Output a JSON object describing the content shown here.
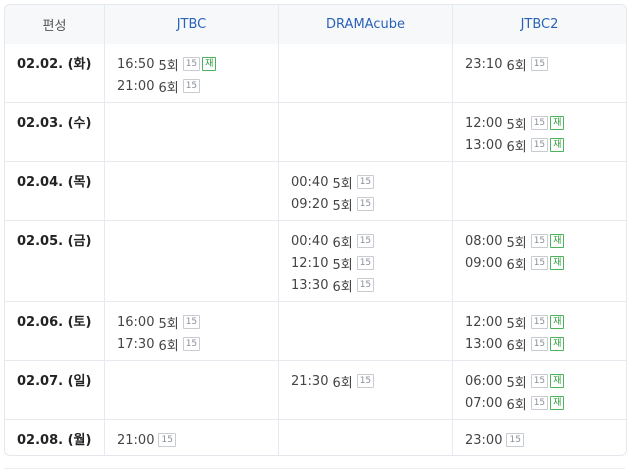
{
  "header": {
    "label": "편성",
    "channels": [
      "JTBC",
      "DRAMAcube",
      "JTBC2"
    ]
  },
  "rows": [
    {
      "date": "02.02. (화)",
      "slots": [
        [
          {
            "time": "16:50",
            "ep": "5회",
            "age": "15",
            "re": "재"
          },
          {
            "time": "21:00",
            "ep": "6회",
            "age": "15"
          }
        ],
        [],
        [
          {
            "time": "23:10",
            "ep": "6회",
            "age": "15"
          }
        ]
      ]
    },
    {
      "date": "02.03. (수)",
      "slots": [
        [],
        [],
        [
          {
            "time": "12:00",
            "ep": "5회",
            "age": "15",
            "re": "재"
          },
          {
            "time": "13:00",
            "ep": "6회",
            "age": "15",
            "re": "재"
          }
        ]
      ]
    },
    {
      "date": "02.04. (목)",
      "slots": [
        [],
        [
          {
            "time": "00:40",
            "ep": "5회",
            "age": "15"
          },
          {
            "time": "09:20",
            "ep": "5회",
            "age": "15"
          }
        ],
        []
      ]
    },
    {
      "date": "02.05. (금)",
      "slots": [
        [],
        [
          {
            "time": "00:40",
            "ep": "6회",
            "age": "15"
          },
          {
            "time": "12:10",
            "ep": "5회",
            "age": "15"
          },
          {
            "time": "13:30",
            "ep": "6회",
            "age": "15"
          }
        ],
        [
          {
            "time": "08:00",
            "ep": "5회",
            "age": "15",
            "re": "재"
          },
          {
            "time": "09:00",
            "ep": "6회",
            "age": "15",
            "re": "재"
          }
        ]
      ]
    },
    {
      "date": "02.06. (토)",
      "slots": [
        [
          {
            "time": "16:00",
            "ep": "5회",
            "age": "15"
          },
          {
            "time": "17:30",
            "ep": "6회",
            "age": "15"
          }
        ],
        [],
        [
          {
            "time": "12:00",
            "ep": "5회",
            "age": "15",
            "re": "재"
          },
          {
            "time": "13:00",
            "ep": "6회",
            "age": "15",
            "re": "재"
          }
        ]
      ]
    },
    {
      "date": "02.07. (일)",
      "slots": [
        [],
        [
          {
            "time": "21:30",
            "ep": "6회",
            "age": "15"
          }
        ],
        [
          {
            "time": "06:00",
            "ep": "5회",
            "age": "15",
            "re": "재"
          },
          {
            "time": "07:00",
            "ep": "6회",
            "age": "15",
            "re": "재"
          }
        ]
      ]
    },
    {
      "date": "02.08. (월)",
      "slots": [
        [
          {
            "time": "21:00",
            "ep": "",
            "age": "15"
          }
        ],
        [],
        [
          {
            "time": "23:00",
            "ep": "",
            "age": "15"
          }
        ]
      ]
    }
  ],
  "colors": {
    "channel_header": "#2a62b8",
    "rerun_badge": "#2f9a3e",
    "age_badge": "#8a9099"
  }
}
